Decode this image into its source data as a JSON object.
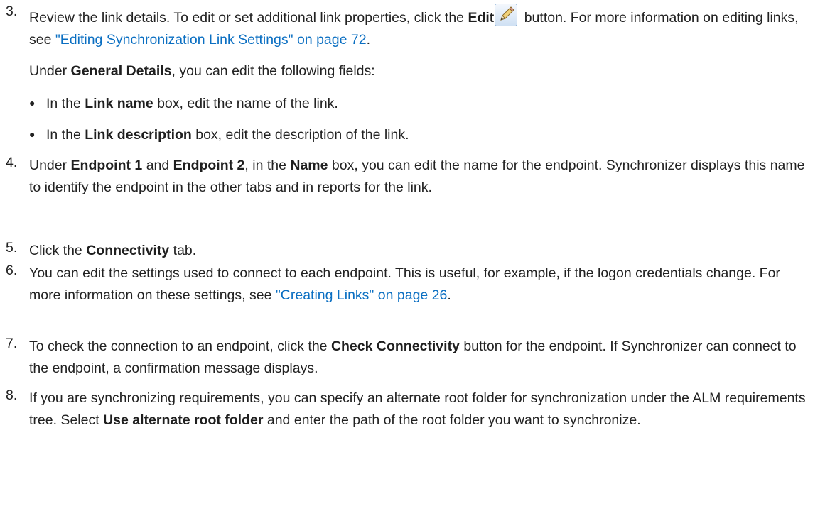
{
  "step3": {
    "number": "3.",
    "text_a": "Review the link details. To edit or set additional link properties, click the ",
    "edit_bold": "Edit",
    "text_b": " button. For more information on editing links, see ",
    "link_text": "\"Editing Synchronization Link Settings\" on page 72",
    "text_c": ".",
    "under_a": "Under ",
    "under_bold": "General Details",
    "under_b": ", you can edit the following fields:",
    "bullets": [
      {
        "a": "In the ",
        "bold": "Link name",
        "b": " box, edit the name of the link."
      },
      {
        "a": "In the ",
        "bold": "Link description",
        "b": " box, edit the description of the link."
      }
    ]
  },
  "step4": {
    "number": "4.",
    "a": "Under ",
    "bold1": "Endpoint 1",
    "b": " and ",
    "bold2": "Endpoint 2",
    "c": ", in the ",
    "bold3": "Name",
    "d": " box, you can edit the name for the endpoint. Synchronizer displays this name to identify the endpoint in the other tabs and in reports for the link."
  },
  "step5": {
    "number": "5.",
    "a": "Click the ",
    "bold": "Connectivity",
    "b": " tab."
  },
  "step6": {
    "number": "6.",
    "a": "You can edit the settings used to connect to each endpoint. This is useful, for example, if the logon credentials change. For more information on these settings, see ",
    "link_text": "\"Creating Links\" on page 26",
    "b": "."
  },
  "step7": {
    "number": "7.",
    "a": "To check the connection to an endpoint, click the ",
    "bold": "Check Connectivity",
    "b": " button for the endpoint. If Synchronizer can connect to the endpoint, a confirmation message displays."
  },
  "step8": {
    "number": "8.",
    "a": "If you are synchronizing requirements, you can specify an alternate root folder for synchronization under the ALM requirements tree. Select ",
    "bold": "Use alternate root folder",
    "b": " and enter the path of the root folder you want to synchronize."
  },
  "colors": {
    "text": "#222222",
    "link": "#0b6fc2",
    "icon_border": "#4a7fb5"
  },
  "icons": {
    "edit": "pencil-icon"
  }
}
